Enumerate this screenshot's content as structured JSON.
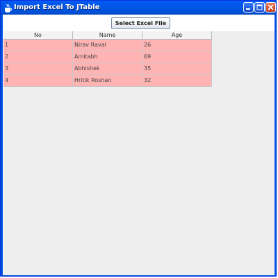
{
  "window": {
    "title": "Import Excel To JTable",
    "controls": [
      "minimize",
      "maximize",
      "close"
    ],
    "icon": "java-cup-icon",
    "title_color": "#ffffff",
    "titlebar_color": "#0054e3",
    "close_color": "#d8512a"
  },
  "toolbar": {
    "select_label": "Select Excel File"
  },
  "table": {
    "columns": [
      "No",
      "Name",
      "Age"
    ],
    "rows": [
      [
        "1",
        "Nirav Raval",
        "26"
      ],
      [
        "2",
        "Amitabh",
        "69"
      ],
      [
        "3",
        "Abhishek",
        "35"
      ],
      [
        "4",
        "Hritik Roshan",
        "32"
      ]
    ],
    "row_color": "#ffb3b3",
    "content_background": "#eeeeee"
  }
}
